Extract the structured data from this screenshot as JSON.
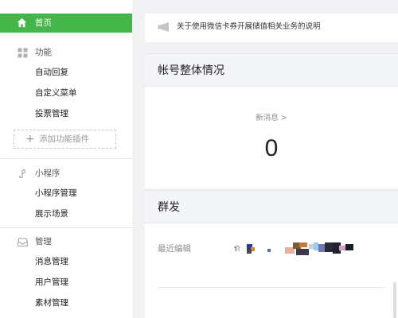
{
  "sidebar": {
    "home": {
      "label": "首页",
      "icon": "home-icon"
    },
    "sections": [
      {
        "label": "功能",
        "icon": "grid-icon",
        "items": [
          "自动回复",
          "自定义菜单",
          "投票管理"
        ],
        "add_plugin": "添加功能插件"
      },
      {
        "label": "小程序",
        "icon": "mini-program-icon",
        "items": [
          "小程序管理",
          "展示场景"
        ]
      },
      {
        "label": "管理",
        "icon": "inbox-icon",
        "items": [
          "消息管理",
          "用户管理",
          "素材管理"
        ]
      }
    ],
    "active_color": "#44b549"
  },
  "main": {
    "notice": {
      "text": "关于使用微信卡券开展储值相关业务的说明",
      "icon": "megaphone-icon"
    },
    "account_overview": {
      "title": "帐号整体情况",
      "new_messages_label": "新消息 >",
      "new_messages_count": "0"
    },
    "mass_send": {
      "title": "群发",
      "recent_edit_label": "最近编辑",
      "recent_edit_prefix": "价"
    }
  }
}
